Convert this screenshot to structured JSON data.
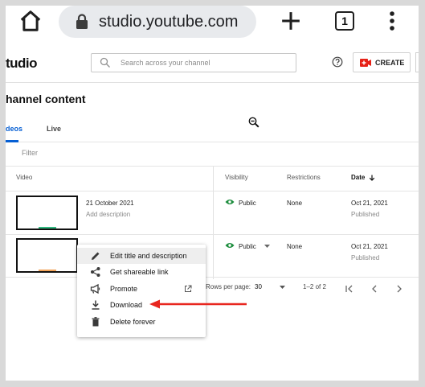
{
  "browser": {
    "url": "studio.youtube.com",
    "tab_count": "1"
  },
  "header": {
    "logo": "tudio",
    "search_placeholder": "Search across your channel",
    "create_label": "CREATE"
  },
  "page": {
    "title": "hannel content",
    "tabs": [
      "deos",
      "Live"
    ],
    "filter_placeholder": "Filter"
  },
  "table": {
    "headers": {
      "video": "Video",
      "visibility": "Visibility",
      "restrictions": "Restrictions",
      "date": "Date"
    },
    "rows": [
      {
        "title": "21 October 2021",
        "description": "Add description",
        "visibility": "Public",
        "restrictions": "None",
        "date": "Oct 21, 2021",
        "status": "Published"
      },
      {
        "title": "",
        "description": "",
        "visibility": "Public",
        "restrictions": "None",
        "date": "Oct 21, 2021",
        "status": "Published"
      }
    ]
  },
  "pagination": {
    "rows_label": "Rows per page:",
    "rows_value": "30",
    "range": "1–2 of 2"
  },
  "menu": {
    "items": [
      "Edit title and description",
      "Get shareable link",
      "Promote",
      "Download",
      "Delete forever"
    ]
  },
  "colors": {
    "accent": "#065fd4",
    "public_green": "#1b8c3c",
    "create_red": "#e62117",
    "annotation_red": "#e8261f"
  }
}
